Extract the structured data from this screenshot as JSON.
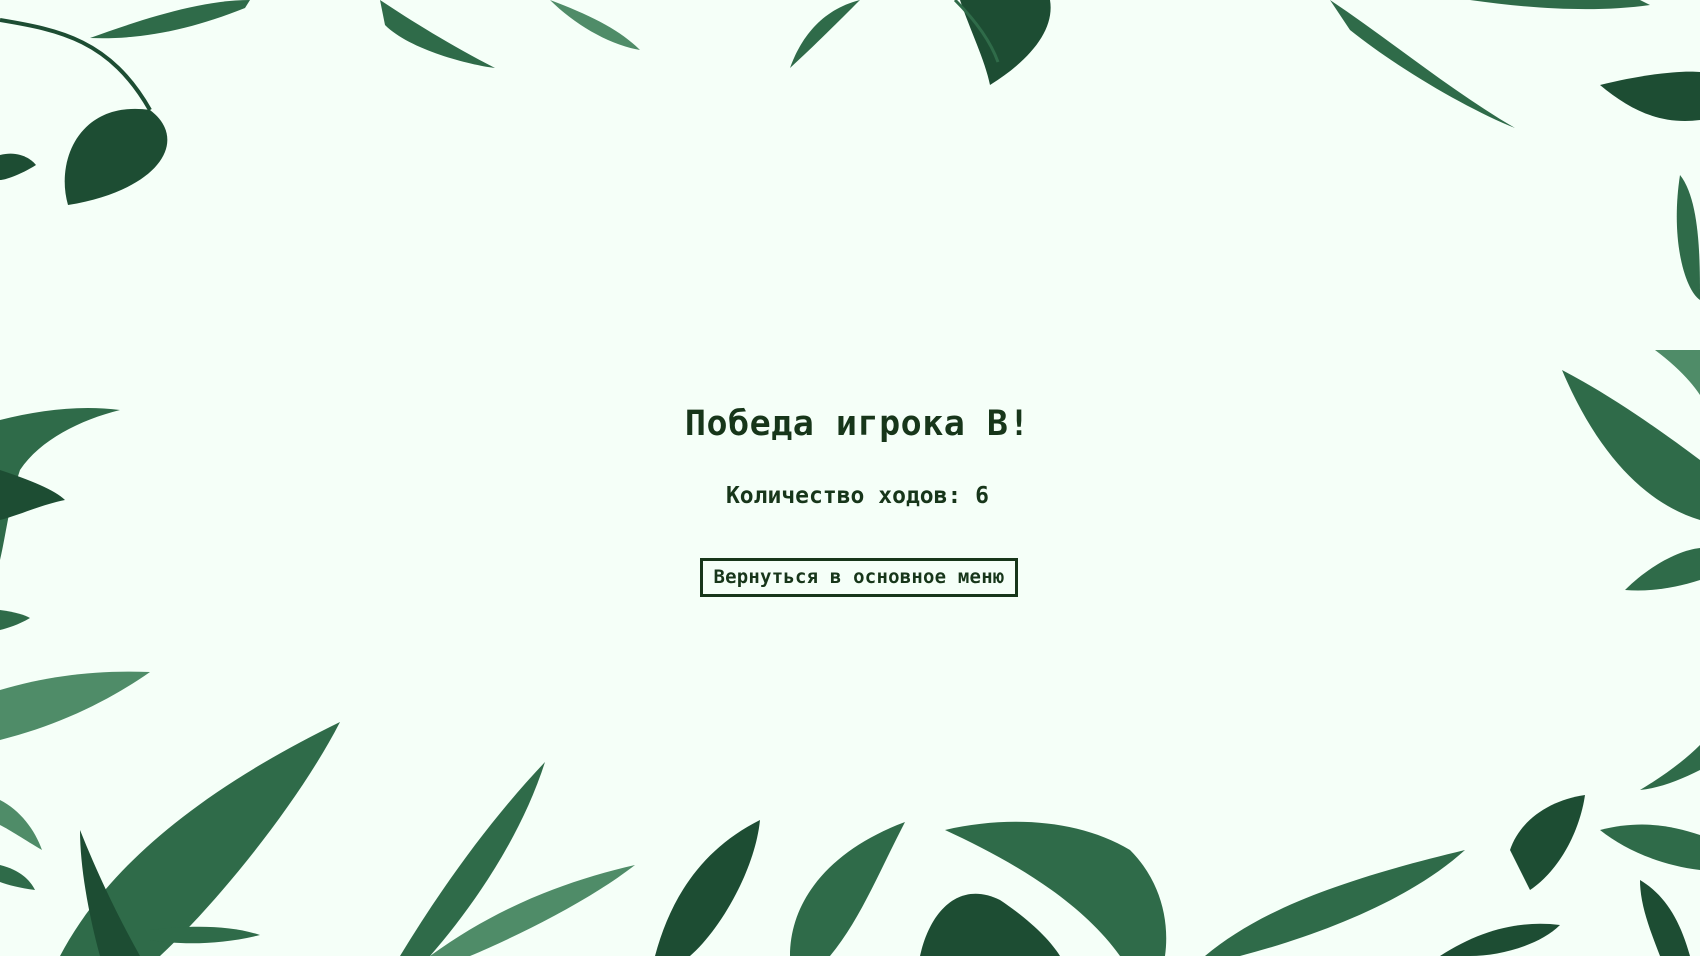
{
  "screen": {
    "title": "Победа игрока В!",
    "moves_text": "Количество ходов: 6",
    "menu_button_label": "Вернуться в основное меню"
  },
  "colors": {
    "background": "#f5fff8",
    "text": "#17361a",
    "leaf_dark": "#1d4d33",
    "leaf_mid": "#2f6b49",
    "leaf_light": "#4f8c68"
  },
  "decoration": "watercolor-leaf-border"
}
